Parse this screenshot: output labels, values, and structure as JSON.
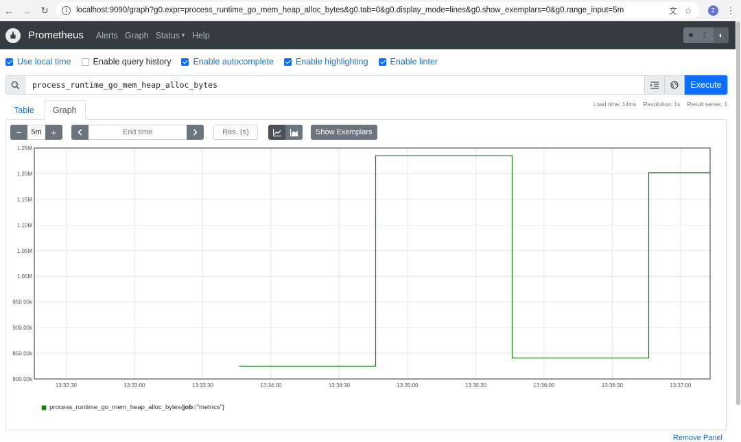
{
  "browser": {
    "url": "localhost:9090/graph?g0.expr=process_runtime_go_mem_heap_alloc_bytes&g0.tab=0&g0.display_mode=lines&g0.show_exemplars=0&g0.range_input=5m",
    "avatar_letter": "Z"
  },
  "navbar": {
    "brand": "Prometheus",
    "links": [
      "Alerts",
      "Graph",
      "Status",
      "Help"
    ]
  },
  "options": [
    {
      "label": "Use local time",
      "checked": true
    },
    {
      "label": "Enable query history",
      "checked": false
    },
    {
      "label": "Enable autocomplete",
      "checked": true
    },
    {
      "label": "Enable highlighting",
      "checked": true
    },
    {
      "label": "Enable linter",
      "checked": true
    }
  ],
  "query": {
    "expr": "process_runtime_go_mem_heap_alloc_bytes",
    "execute_label": "Execute"
  },
  "tabs": [
    "Table",
    "Graph"
  ],
  "stats": {
    "load_time": "Load time: 14ms",
    "resolution": "Resolution: 1s",
    "result_series": "Result series: 1"
  },
  "controls": {
    "minus": "−",
    "range": "5m",
    "plus": "+",
    "end_time_placeholder": "End time",
    "res_placeholder": "Res. (s)",
    "exemplars_label": "Show Exemplars"
  },
  "chart_data": {
    "type": "line",
    "x_tick_labels": [
      "13:32:30",
      "13:33:00",
      "13:33:30",
      "13:34:00",
      "13:34:30",
      "13:35:00",
      "13:35:30",
      "13:36:00",
      "13:36:30",
      "13:37:00"
    ],
    "y_tick_labels": [
      "800.00k",
      "850.00k",
      "900.00k",
      "950.00k",
      "1.00M",
      "1.05M",
      "1.10M",
      "1.15M",
      "1.20M",
      "1.25M"
    ],
    "xlim": [
      "13:32:16",
      "13:37:13"
    ],
    "ylim": [
      800000,
      1250000
    ],
    "series": [
      {
        "name": "process_runtime_go_mem_heap_alloc_bytes{job=\"metrics\"}",
        "color": "#117a11",
        "step": true,
        "points": [
          [
            "13:33:46",
            825000
          ],
          [
            "13:34:46",
            825000
          ],
          [
            "13:34:46",
            1235000
          ],
          [
            "13:35:46",
            1235000
          ],
          [
            "13:35:46",
            841000
          ],
          [
            "13:36:46",
            841000
          ],
          [
            "13:36:46",
            1202000
          ],
          [
            "13:37:13",
            1202000
          ]
        ]
      }
    ],
    "grid": true
  },
  "legend": {
    "metric": "process_runtime_go_mem_heap_alloc_bytes{",
    "label_key": "job",
    "label_value": "=\"metrics\"}"
  },
  "remove_panel": "Remove Panel"
}
